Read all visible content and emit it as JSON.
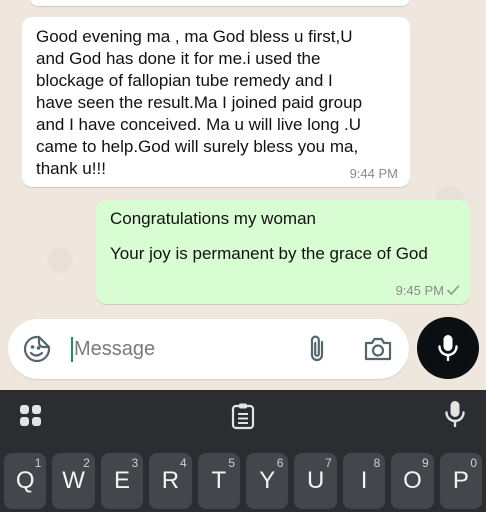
{
  "chat": {
    "incoming": {
      "text": "Good evening ma , ma God bless u first,U\nand God has done it for me.i used the\nblockage of fallopian tube remedy and I\nhave seen the result.Ma I joined paid group\nand I have conceived. Ma u will live long .U\ncame to help.God will surely bless you ma,\nthank u!!!",
      "time": "9:44 PM"
    },
    "outgoing": {
      "line1": "Congratulations my woman",
      "line2": "Your joy is permanent by the grace of God",
      "time": "9:45 PM",
      "status_icon": "single-check-icon"
    }
  },
  "composer": {
    "placeholder": "Message",
    "emoji_icon": "sticker-emoji-icon",
    "attach_icon": "paperclip-icon",
    "camera_icon": "camera-icon",
    "send_icon": "microphone-icon"
  },
  "keyboard": {
    "toolbar": [
      "apps-grid-icon",
      "clipboard-icon",
      "microphone-icon"
    ],
    "row1": [
      {
        "label": "Q",
        "num": "1"
      },
      {
        "label": "W",
        "num": "2"
      },
      {
        "label": "E",
        "num": "3"
      },
      {
        "label": "R",
        "num": "4"
      },
      {
        "label": "T",
        "num": "5"
      },
      {
        "label": "Y",
        "num": "6"
      },
      {
        "label": "U",
        "num": "7"
      },
      {
        "label": "I",
        "num": "8"
      },
      {
        "label": "O",
        "num": "9"
      },
      {
        "label": "P",
        "num": "0"
      }
    ]
  },
  "colors": {
    "chat_bg": "#efe7de",
    "incoming_bubble": "#ffffff",
    "outgoing_bubble": "#d9fdd3",
    "fab": "#0b0f12",
    "keyboard_bg": "#2b2d31",
    "key_bg": "#43464b",
    "check": "#53bdeb"
  }
}
